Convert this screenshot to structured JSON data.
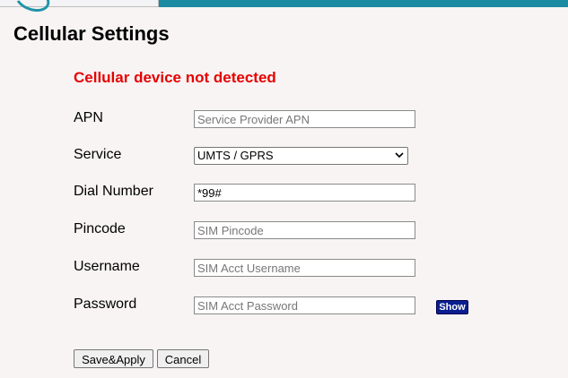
{
  "page": {
    "title": "Cellular Settings",
    "alert": "Cellular device not detected",
    "alert_color": "#e60000"
  },
  "form": {
    "apn": {
      "label": "APN",
      "value": "",
      "placeholder": "Service Provider APN"
    },
    "service": {
      "label": "Service",
      "selected": "UMTS / GPRS"
    },
    "dial_number": {
      "label": "Dial Number",
      "value": "*99#",
      "placeholder": ""
    },
    "pincode": {
      "label": "Pincode",
      "value": "",
      "placeholder": "SIM Pincode"
    },
    "username": {
      "label": "Username",
      "value": "",
      "placeholder": "SIM Acct Username"
    },
    "password": {
      "label": "Password",
      "value": "",
      "placeholder": "SIM Acct Password",
      "show_label": "Show"
    }
  },
  "actions": {
    "save_label": "Save&Apply",
    "cancel_label": "Cancel"
  },
  "icons": {
    "logo": "logo-arc-icon",
    "select_arrow": "chevron-down-icon"
  }
}
